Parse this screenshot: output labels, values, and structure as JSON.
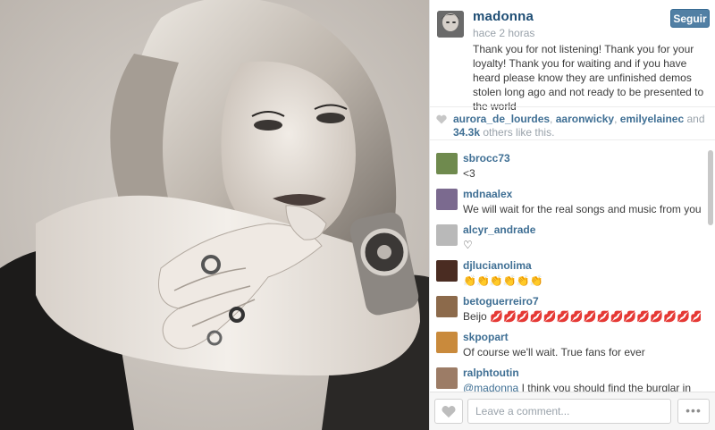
{
  "post": {
    "owner": "madonna",
    "time": "hace 2 horas",
    "follow_label": "Seguir",
    "caption": "Thank you for not listening! Thank you for your loyalty! Thank you for waiting and if you have heard please know they are unfinished demos stolen long ago and not ready to be presented to the world"
  },
  "likes": {
    "users": [
      "aurora_de_lourdes",
      "aaronwicky",
      "emilyelainec"
    ],
    "sep1": ", ",
    "sep2": ", ",
    "and": " and ",
    "count": "34.3k",
    "suffix": " others like this."
  },
  "comments": [
    {
      "user": "sbrocc73",
      "text": "<3",
      "avatar_color": "#6f8a4e"
    },
    {
      "user": "mdnaalex",
      "text": "We will wait for the real songs and music from you! 💜",
      "avatar_color": "#7b6a8f"
    },
    {
      "user": "alcyr_andrade",
      "text": "♡",
      "avatar_color": "#b9b9b9"
    },
    {
      "user": "djlucianolima",
      "text": "👏👏👏👏👏👏",
      "avatar_color": "#4a2c22"
    },
    {
      "user": "betoguerreiro7",
      "text": "Beijo 💋💋💋💋💋💋💋💋💋💋💋💋💋💋💋💋💋💋 💋",
      "avatar_color": "#8c6a4b"
    },
    {
      "user": "skpopart",
      "text": "Of course we'll wait. True fans for ever",
      "avatar_color": "#c98a3c"
    },
    {
      "user": "ralphtoutin",
      "mention": "@madonna",
      "text": " I think you should find the burglar in your team. There is someone there who is taking",
      "avatar_color": "#9c7c66"
    }
  ],
  "footer": {
    "comment_placeholder": "Leave a comment...",
    "more_label": "•••"
  },
  "colors": {
    "link": "#3f6f94",
    "button": "#517fa4"
  }
}
